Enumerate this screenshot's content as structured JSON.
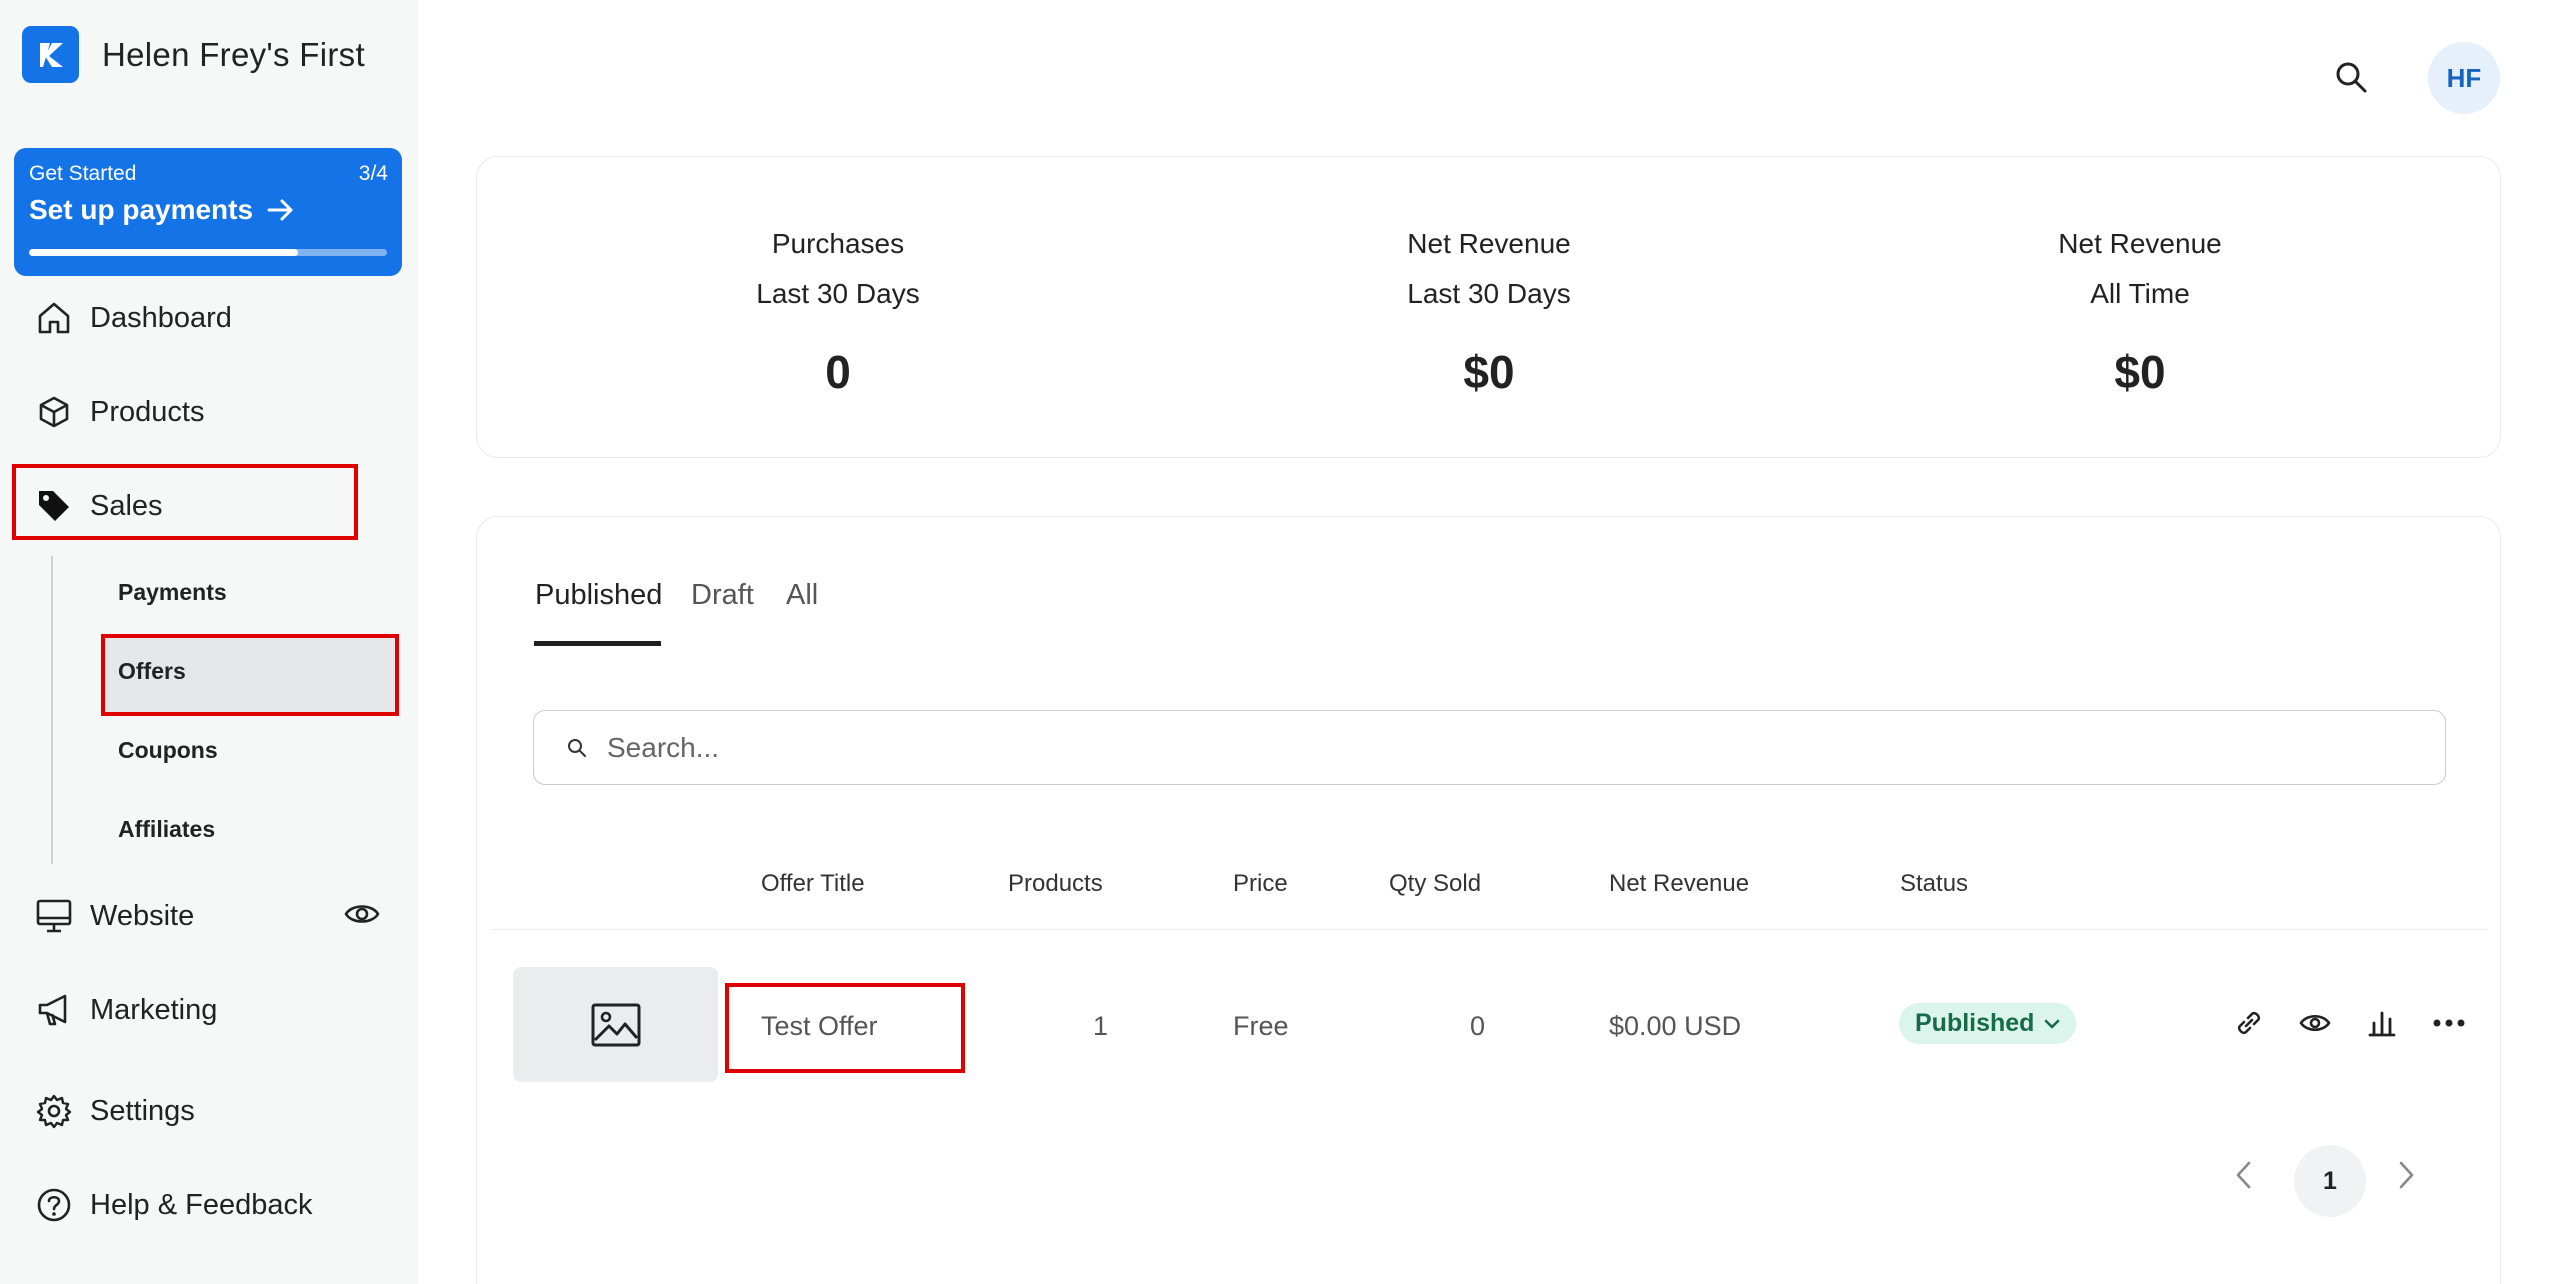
{
  "brand": {
    "name": "Helen Frey's First"
  },
  "get_started": {
    "label": "Get Started",
    "count": "3/4",
    "title": "Set up payments",
    "progress": 0.75
  },
  "nav": {
    "dashboard": "Dashboard",
    "products": "Products",
    "sales": "Sales",
    "sales_sub": {
      "payments": "Payments",
      "offers": "Offers",
      "coupons": "Coupons",
      "affiliates": "Affiliates"
    },
    "website": "Website",
    "marketing": "Marketing",
    "settings": "Settings",
    "help": "Help & Feedback"
  },
  "header": {
    "avatar_initials": "HF"
  },
  "stats": [
    {
      "line1": "Purchases",
      "line2": "Last 30 Days",
      "value": "0"
    },
    {
      "line1": "Net Revenue",
      "line2": "Last 30 Days",
      "value": "$0"
    },
    {
      "line1": "Net Revenue",
      "line2": "All Time",
      "value": "$0"
    }
  ],
  "tabs": {
    "published": "Published",
    "draft": "Draft",
    "all": "All"
  },
  "search": {
    "placeholder": "Search..."
  },
  "table": {
    "headers": {
      "title": "Offer Title",
      "products": "Products",
      "price": "Price",
      "qty": "Qty Sold",
      "revenue": "Net Revenue",
      "status": "Status"
    },
    "rows": [
      {
        "title": "Test Offer",
        "products": "1",
        "price": "Free",
        "qty": "0",
        "revenue": "$0.00 USD",
        "status": "Published"
      }
    ]
  },
  "pagination": {
    "current": "1"
  },
  "colors": {
    "brand_blue": "#1473e6",
    "status_green_bg": "#dcf5ec",
    "highlight_red": "#e10000"
  }
}
